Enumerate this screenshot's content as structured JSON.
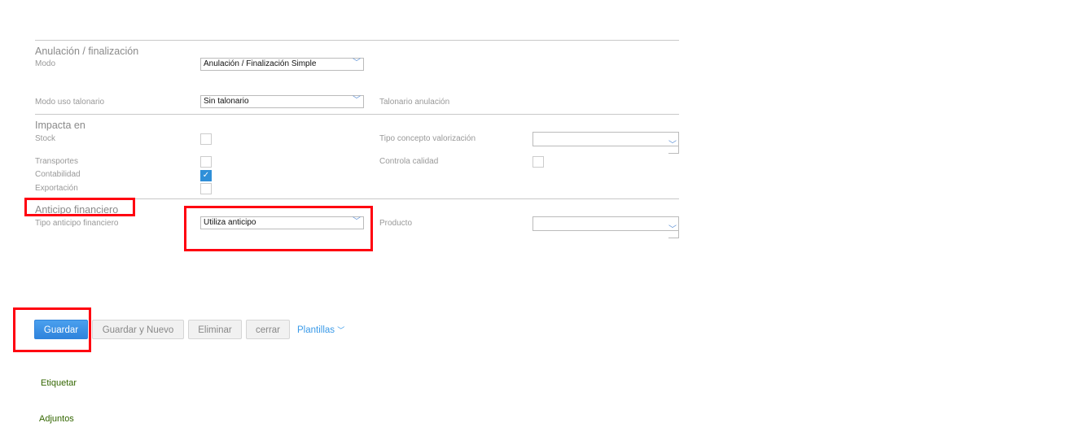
{
  "sections": {
    "anulacion": "Anulación / finalización",
    "impacta": "Impacta en",
    "anticipo": "Anticipo financiero"
  },
  "fields": {
    "modo": {
      "label": "Modo",
      "value": "Anulación / Finalización Simple"
    },
    "modo_talonario": {
      "label": "Modo uso talonario",
      "value": "Sin talonario"
    },
    "talonario_anulacion": {
      "label": "Talonario anulación"
    },
    "stock": {
      "label": "Stock",
      "checked": false
    },
    "transportes": {
      "label": "Transportes",
      "checked": false
    },
    "contabilidad": {
      "label": "Contabilidad",
      "checked": true
    },
    "exportacion": {
      "label": "Exportación",
      "checked": false
    },
    "tipo_concepto": {
      "label": "Tipo concepto valorización",
      "value": ""
    },
    "controla_calidad": {
      "label": "Controla calidad",
      "checked": false
    },
    "tipo_anticipo": {
      "label": "Tipo anticipo financiero",
      "value": "Utiliza anticipo"
    },
    "producto": {
      "label": "Producto",
      "value": ""
    }
  },
  "buttons": {
    "guardar": "Guardar",
    "guardar_nuevo": "Guardar y Nuevo",
    "eliminar": "Eliminar",
    "cerrar": "cerrar",
    "plantillas": "Plantillas"
  },
  "links": {
    "etiquetar": "Etiquetar",
    "adjuntos": "Adjuntos"
  },
  "colors": {
    "accent": "#2f8fd8",
    "highlight": "#ff0010",
    "link": "#336600"
  }
}
